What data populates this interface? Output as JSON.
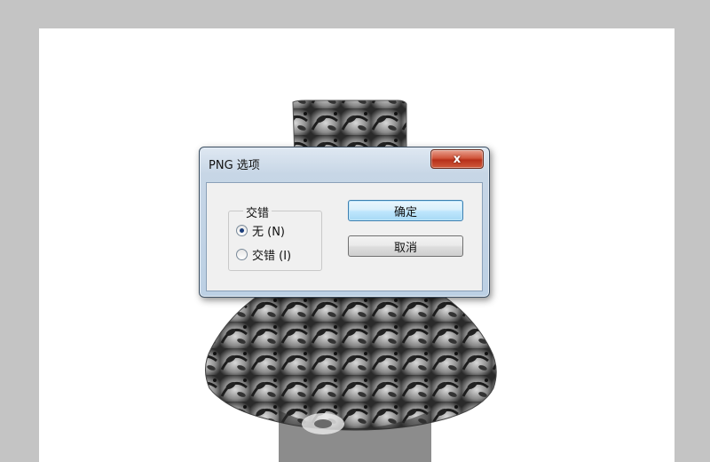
{
  "dialog": {
    "title": "PNG 选项",
    "close_label": "x",
    "group_label": "交错",
    "options": [
      {
        "label": "无 (N)",
        "checked": true
      },
      {
        "label": "交错 (I)",
        "checked": false
      }
    ],
    "ok_label": "确定",
    "cancel_label": "取消"
  }
}
